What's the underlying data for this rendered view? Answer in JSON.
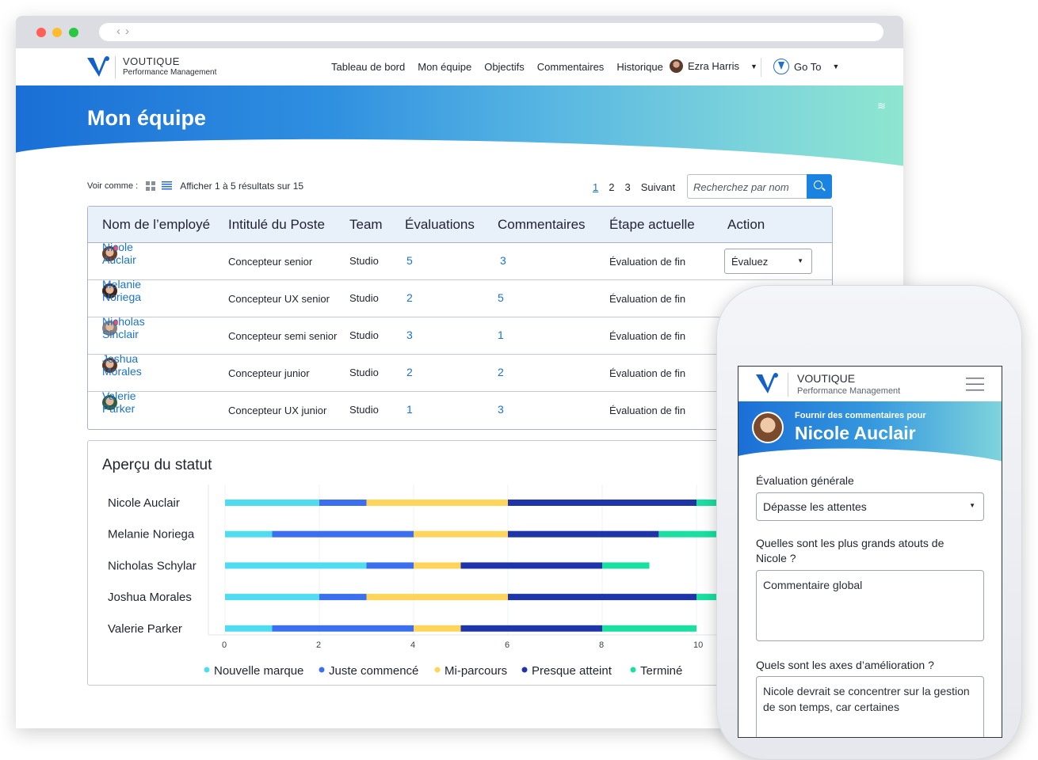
{
  "app": {
    "brand_name": "VOUTIQUE",
    "brand_sub": "Performance Management",
    "colors": {
      "primary": "#1a73c9",
      "hero_start": "#1a6fd6",
      "hero_end": "#8ee6cf"
    }
  },
  "nav": {
    "links": [
      "Tableau de bord",
      "Mon équipe",
      "Objectifs",
      "Commentaires",
      "Historique"
    ],
    "user_name": "Ezra Harris",
    "goto_label": "Go To"
  },
  "page": {
    "title": "Mon équipe"
  },
  "toolbar": {
    "view_label": "Voir comme :",
    "results_text": "Afficher 1 à 5 résultats sur 15",
    "pages": [
      "1",
      "2",
      "3"
    ],
    "next_label": "Suivant",
    "search_placeholder": "Recherchez par nom"
  },
  "table": {
    "headers": [
      "Nom de l’employé",
      "Intitulé du Poste",
      "Team",
      "Évaluations",
      "Commentaires",
      "Étape actuelle",
      "Action"
    ],
    "rows": [
      {
        "name": "Nicole Auclair",
        "title": "Concepteur senior",
        "team": "Studio",
        "evaluations": "5",
        "comments": "3",
        "stage": "Évaluation de fin",
        "action": "Évaluez"
      },
      {
        "name": "Melanie Noriega",
        "title": "Concepteur UX senior",
        "team": "Studio",
        "evaluations": "2",
        "comments": "5",
        "stage": "Évaluation de fin",
        "action": ""
      },
      {
        "name": "Nicholas Sinclair",
        "title": "Concepteur semi senior",
        "team": "Studio",
        "evaluations": "3",
        "comments": "1",
        "stage": "Évaluation de fin",
        "action": ""
      },
      {
        "name": "Joshua Morales",
        "title": "Concepteur junior",
        "team": "Studio",
        "evaluations": "2",
        "comments": "2",
        "stage": "Évaluation de fin",
        "action": ""
      },
      {
        "name": "Valerie Parker",
        "title": "Concepteur UX junior",
        "team": "Studio",
        "evaluations": "1",
        "comments": "3",
        "stage": "Évaluation de fin",
        "action": ""
      }
    ]
  },
  "status": {
    "title": "Aperçu du statut"
  },
  "chart_data": {
    "type": "bar",
    "orientation": "horizontal",
    "stacked": true,
    "categories": [
      "Nicole Auclair",
      "Melanie Noriega",
      "Nicholas Schylar",
      "Joshua Morales",
      "Valerie Parker"
    ],
    "series": [
      {
        "name": "Nouvelle marque",
        "color": "#4fdcf0",
        "values": [
          2,
          1,
          3,
          2,
          1
        ]
      },
      {
        "name": "Juste commencé",
        "color": "#3b6ff0",
        "values": [
          1,
          3,
          1,
          1,
          3
        ]
      },
      {
        "name": "Mi-parcours",
        "color": "#ffd45a",
        "values": [
          3,
          2,
          1,
          3,
          1
        ]
      },
      {
        "name": "Presque atteint",
        "color": "#1d35a8",
        "values": [
          4,
          3.2,
          3,
          4,
          3
        ]
      },
      {
        "name": "Terminé",
        "color": "#19e0a0",
        "values": [
          1,
          1.8,
          1,
          1,
          2
        ]
      }
    ],
    "xticks": [
      "0",
      "2",
      "4",
      "6",
      "8",
      "10"
    ],
    "xlim": [
      0,
      12
    ],
    "legend": "bottom"
  },
  "mobile": {
    "banner_sub": "Fournir des commentaires pour",
    "banner_name": "Nicole Auclair",
    "overall_label": "Évaluation générale",
    "overall_value": "Dépasse les attentes",
    "strengths_label": "Quelles sont les plus grands atouts de Nicole ?",
    "strengths_value": "Commentaire global",
    "improve_label": "Quels sont les axes d’amélioration ?",
    "improve_value": "Nicole devrait se concentrer sur la gestion de son temps, car certaines"
  }
}
